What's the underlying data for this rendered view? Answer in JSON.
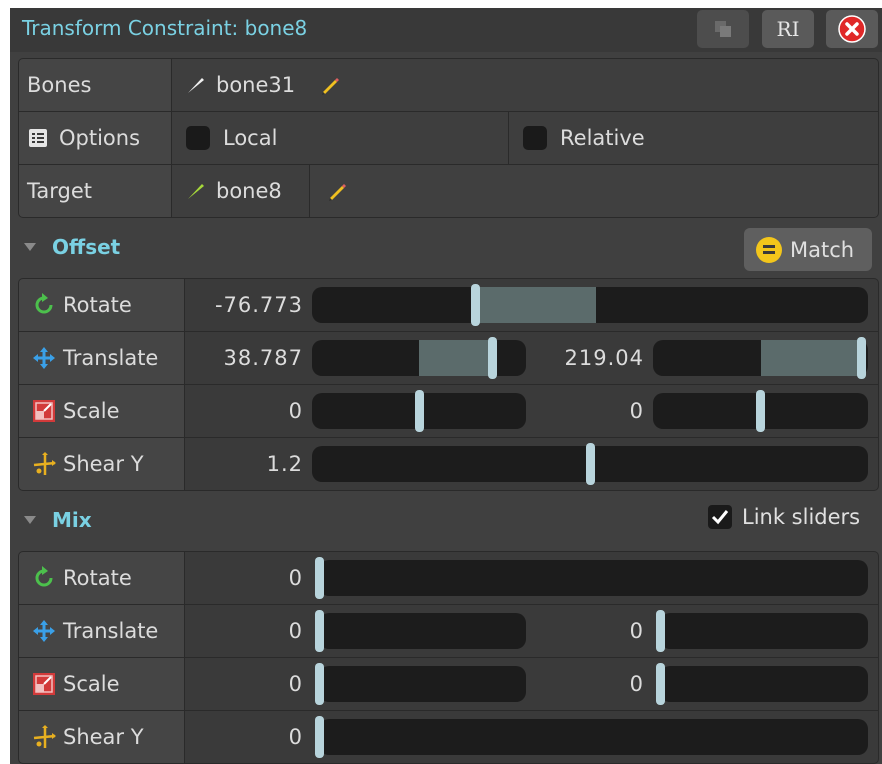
{
  "window": {
    "title": "Transform Constraint: bone8",
    "rename_label": "RI"
  },
  "properties": {
    "bones_label": "Bones",
    "bones_value": "bone31",
    "options_label": "Options",
    "local_label": "Local",
    "relative_label": "Relative",
    "target_label": "Target",
    "target_value": "bone8"
  },
  "offset": {
    "header": "Offset",
    "match_label": "Match",
    "rows": {
      "rotate": {
        "label": "Rotate",
        "value": "-76.773",
        "level": 0.29,
        "fill_to": 0.51
      },
      "translate": {
        "label": "Translate",
        "value_x": "38.787",
        "level_x": 0.86,
        "value_y": "219.04",
        "level_y": 0.99
      },
      "scale": {
        "label": "Scale",
        "value_x": "0",
        "level_x": 0.5,
        "value_y": "0",
        "level_y": 0.5
      },
      "shear": {
        "label": "Shear Y",
        "value": "1.2",
        "level": 0.5
      }
    }
  },
  "mix": {
    "header": "Mix",
    "link_sliders_label": "Link sliders",
    "link_sliders_checked": true,
    "rows": {
      "rotate": {
        "label": "Rotate",
        "value": "0",
        "level": 0
      },
      "translate": {
        "label": "Translate",
        "value_x": "0",
        "level_x": 0,
        "value_y": "0",
        "level_y": 0
      },
      "scale": {
        "label": "Scale",
        "value_x": "0",
        "level_x": 0,
        "value_y": "0",
        "level_y": 0
      },
      "shear": {
        "label": "Shear Y",
        "value": "0",
        "level": 0
      }
    }
  },
  "colors": {
    "title_accent": "#7ad1e3",
    "rotate_icon": "#4cc04c",
    "translate_icon": "#3aa0e8",
    "scale_icon": "#d23a3a",
    "shear_icon": "#e8b020",
    "close_button": "#e02828",
    "match_icon": "#f3c61b"
  },
  "icons": {
    "duplicate": "duplicate-icon",
    "rename": "rename-icon",
    "close": "close-icon",
    "bone": "bone-icon",
    "pencil": "pencil-icon",
    "options": "options-list-icon",
    "rotate": "rotate-icon",
    "translate": "translate-arrows-icon",
    "scale": "scale-icon",
    "shear": "shear-icon",
    "match": "match-icon",
    "checkmark": "checkmark-icon"
  }
}
